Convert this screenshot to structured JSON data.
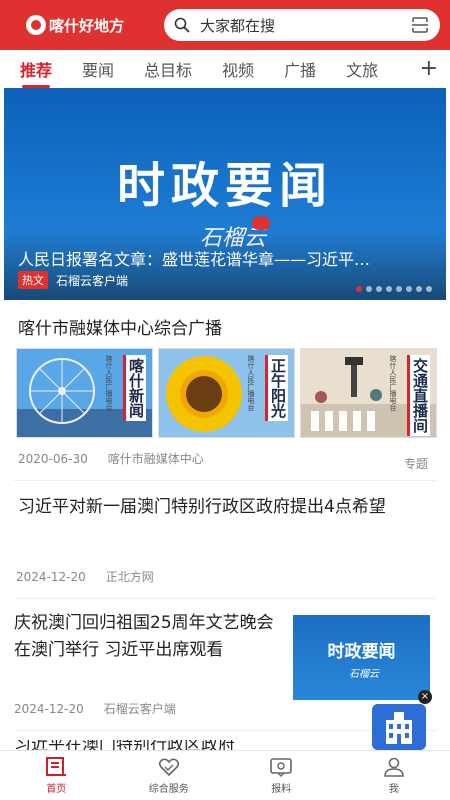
{
  "header": {
    "app_name": "喀什好地方",
    "search_placeholder": "大家都在搜"
  },
  "tabs": [
    "推荐",
    "要闻",
    "总目标",
    "视频",
    "广播",
    "文旅"
  ],
  "tab_more": "+",
  "banner": {
    "image_title": "时政要闻",
    "image_brand": "石榴云",
    "headline": "人民日报署名文章：盛世莲花谱华章——习近平…",
    "tag": "热文",
    "source": "石榴云客户端",
    "slide_count": 8,
    "active_slide": 1
  },
  "articles": [
    {
      "title": "喀什市融媒体中心综合广播",
      "thumbs": [
        {
          "title": "喀什新闻",
          "sub": "喀什人民广播电台"
        },
        {
          "title": "正午阳光",
          "sub": "喀什人民广播电台"
        },
        {
          "title": "交通直播间",
          "sub": "喀什人民广播电台"
        }
      ],
      "date": "2020-06-30",
      "source": "喀什市融媒体中心",
      "label": "专题"
    },
    {
      "title": "习近平对新一届澳门特别行政区政府提出4点希望",
      "date": "2024-12-20",
      "source": "正北方网"
    },
    {
      "title": "庆祝澳门回归祖国25周年文艺晚会在澳门举行 习近平出席观看",
      "image_title": "时政要闻",
      "image_brand": "石榴云",
      "date": "2024-12-20",
      "source": "石榴云客户端"
    },
    {
      "title": "习近平在澳门特别行政区政府"
    }
  ],
  "float_close": "×",
  "bottom_nav": [
    {
      "label": "首页",
      "icon": "home-news-icon",
      "active": true
    },
    {
      "label": "综合服务",
      "icon": "heart-service-icon",
      "active": false
    },
    {
      "label": "报料",
      "icon": "report-icon",
      "active": false
    },
    {
      "label": "我",
      "icon": "user-icon",
      "active": false
    }
  ],
  "colors": {
    "brand_red": "#e03131",
    "active_red": "#d9232d",
    "banner_blue": "#1a78d0"
  }
}
